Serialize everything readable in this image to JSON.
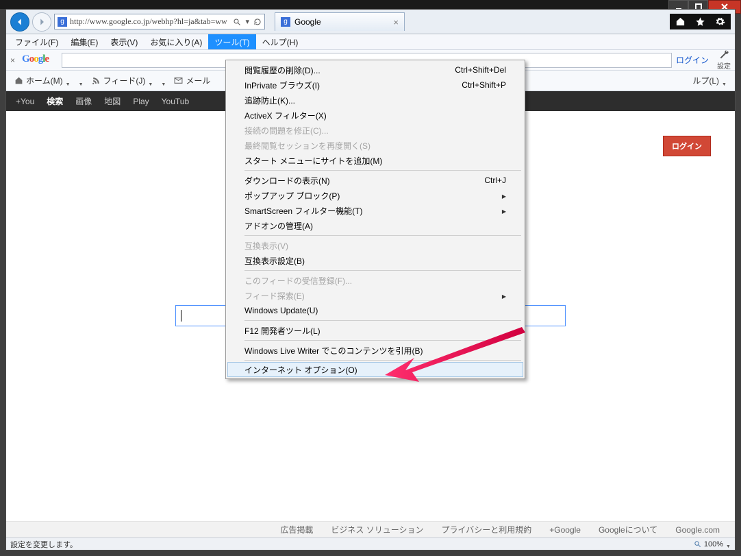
{
  "window": {
    "caption_min": "_",
    "caption_max": "□",
    "caption_close": "×"
  },
  "nav": {
    "url": "http://www.google.co.jp/webhp?hl=ja&tab=ww",
    "search_glyph": "🔍",
    "refresh_glyph": "⟳",
    "tab_title": "Google",
    "favicon_letter": "g"
  },
  "nav_right": {
    "home_icon": "home",
    "star_icon": "star",
    "gear_icon": "gear"
  },
  "menu_bar": {
    "items": [
      {
        "label": "ファイル(F)",
        "active": false
      },
      {
        "label": "編集(E)",
        "active": false
      },
      {
        "label": "表示(V)",
        "active": false
      },
      {
        "label": "お気に入り(A)",
        "active": false
      },
      {
        "label": "ツール(T)",
        "active": true
      },
      {
        "label": "ヘルプ(H)",
        "active": false
      }
    ]
  },
  "toolbar1": {
    "close_x": "×",
    "search_placeholder": "",
    "login_link": "ログイン",
    "settings_label": "設定"
  },
  "toolbar2": {
    "items": [
      {
        "icon": "home",
        "label": "ホーム(M)"
      },
      {
        "icon": "rss",
        "label": "フィード(J)"
      },
      {
        "icon": "mail",
        "label": "メール"
      },
      {
        "icon": "help",
        "label": "ルプ(L)"
      }
    ]
  },
  "google_blackbar": {
    "items": [
      "+You",
      "検索",
      "画像",
      "地図",
      "Play",
      "YouTub"
    ]
  },
  "page": {
    "login_button": "ログイン"
  },
  "dropdown": {
    "groups": [
      [
        {
          "label": "閲覧履歴の削除(D)...",
          "shortcut": "Ctrl+Shift+Del"
        },
        {
          "label": "InPrivate ブラウズ(I)",
          "shortcut": "Ctrl+Shift+P"
        },
        {
          "label": "追跡防止(K)..."
        },
        {
          "label": "ActiveX フィルター(X)"
        },
        {
          "label": "接続の問題を修正(C)...",
          "disabled": true
        },
        {
          "label": "最終閲覧セッションを再度開く(S)",
          "disabled": true
        },
        {
          "label": "スタート メニューにサイトを追加(M)"
        }
      ],
      [
        {
          "label": "ダウンロードの表示(N)",
          "shortcut": "Ctrl+J"
        },
        {
          "label": "ポップアップ ブロック(P)",
          "sub": true
        },
        {
          "label": "SmartScreen フィルター機能(T)",
          "sub": true
        },
        {
          "label": "アドオンの管理(A)"
        }
      ],
      [
        {
          "label": "互換表示(V)",
          "disabled": true
        },
        {
          "label": "互換表示設定(B)"
        }
      ],
      [
        {
          "label": "このフィードの受信登録(F)...",
          "disabled": true
        },
        {
          "label": "フィード探索(E)",
          "disabled": true,
          "sub": true
        },
        {
          "label": "Windows Update(U)"
        }
      ],
      [
        {
          "label": "F12 開発者ツール(L)"
        }
      ],
      [
        {
          "label": "Windows Live Writer でこのコンテンツを引用(B)"
        }
      ],
      [
        {
          "label": "インターネット オプション(O)",
          "highlight": true
        }
      ]
    ]
  },
  "footer": {
    "links": [
      "広告掲載",
      "ビジネス ソリューション",
      "プライバシーと利用規約",
      "+Google",
      "Googleについて",
      "Google.com"
    ]
  },
  "status": {
    "text": "設定を変更します。",
    "zoom": "100%"
  }
}
